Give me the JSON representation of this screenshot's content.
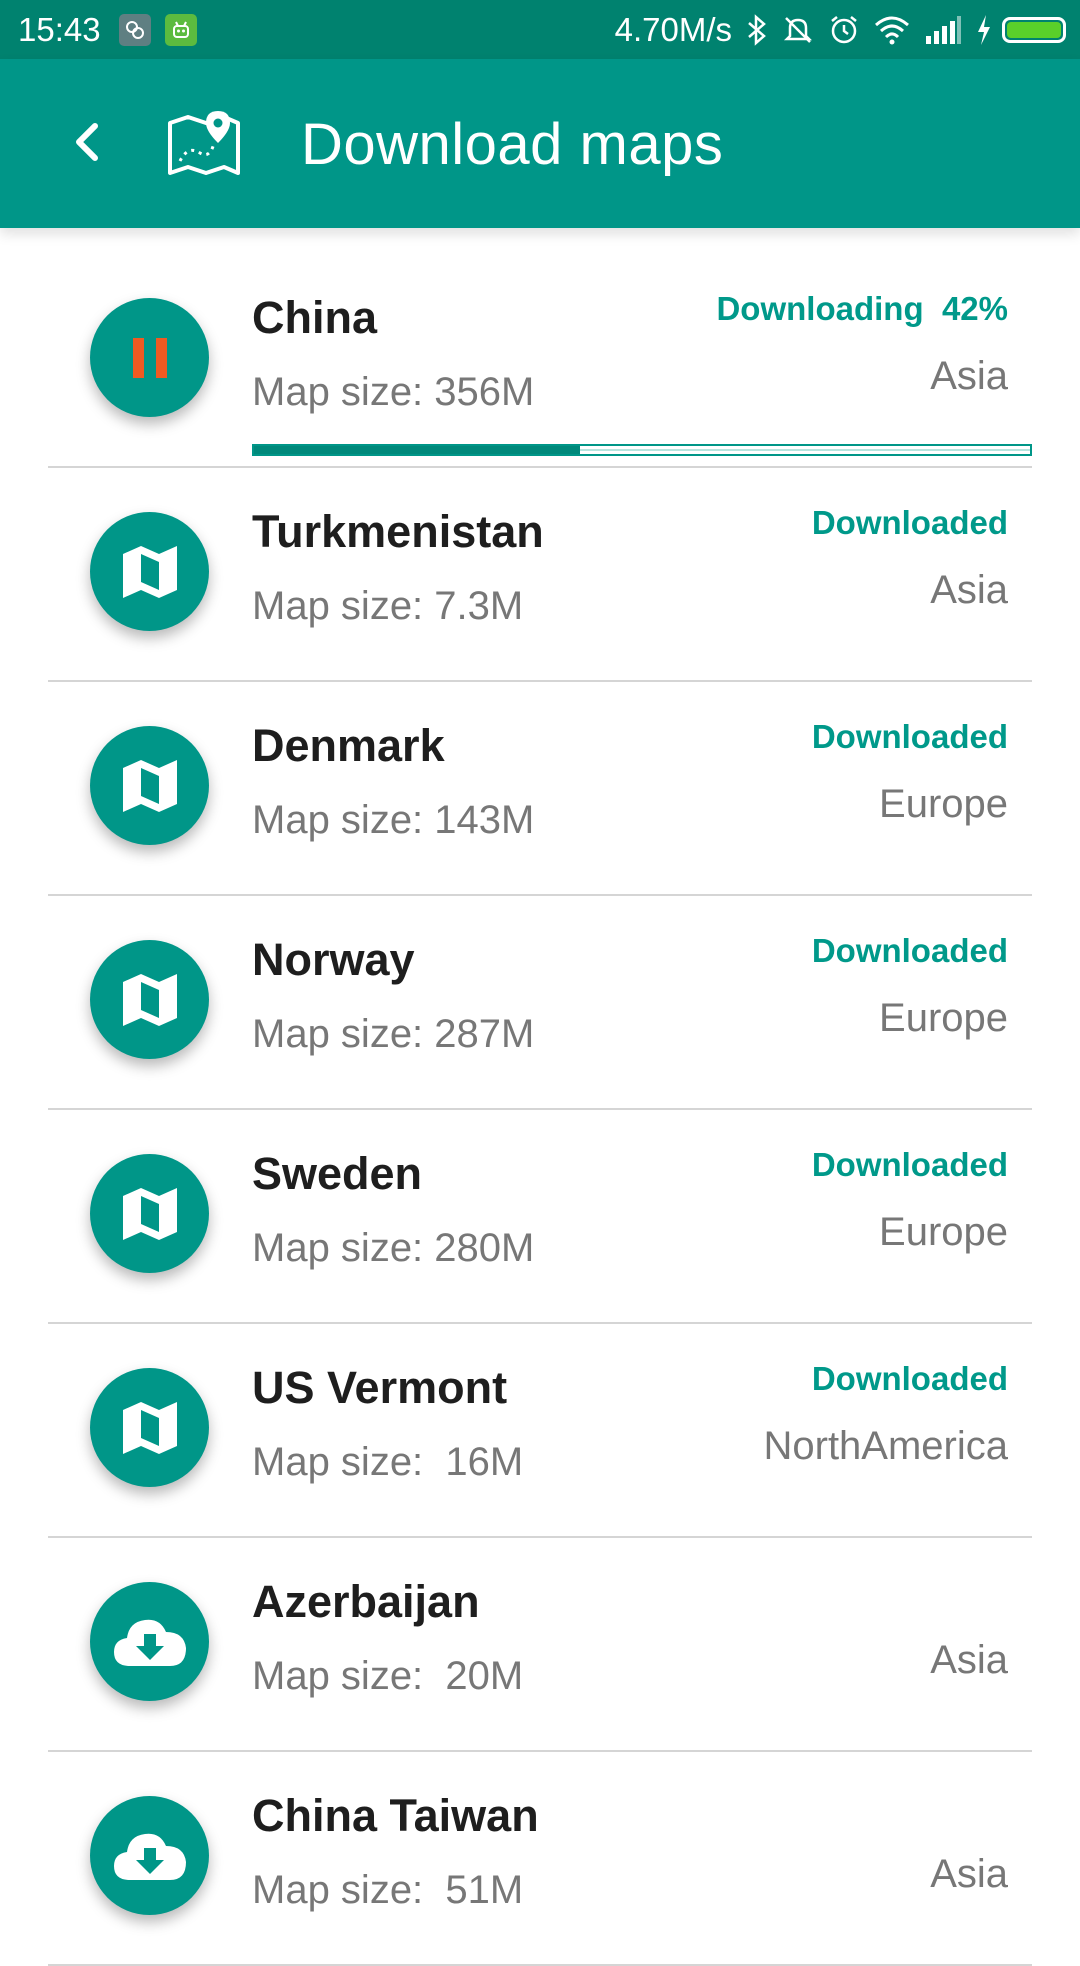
{
  "status_bar": {
    "time": "15:43",
    "speed": "4.70M/s",
    "icons": [
      "notification-app-icon",
      "android-icon",
      "bluetooth-icon",
      "silent-icon",
      "alarm-icon",
      "wifi-icon",
      "signal-icon",
      "charging-icon",
      "battery-icon"
    ]
  },
  "app_bar": {
    "title": "Download maps",
    "back_icon": "back-icon",
    "logo_icon": "map-pin-logo-icon"
  },
  "colors": {
    "primary": "#009688",
    "status_bar": "#00826f",
    "accent_text": "#00998a",
    "pause": "#f05a22"
  },
  "items": [
    {
      "name": "China",
      "size": "Map size: 356M",
      "status": "Downloading  42%",
      "region": "Asia",
      "icon": "pause-icon",
      "progress": 0.42
    },
    {
      "name": "Turkmenistan",
      "size": "Map size: 7.3M",
      "status": "Downloaded",
      "region": "Asia",
      "icon": "map-icon"
    },
    {
      "name": "Denmark",
      "size": "Map size: 143M",
      "status": "Downloaded",
      "region": "Europe",
      "icon": "map-icon"
    },
    {
      "name": "Norway",
      "size": "Map size: 287M",
      "status": "Downloaded",
      "region": "Europe",
      "icon": "map-icon"
    },
    {
      "name": "Sweden",
      "size": "Map size: 280M",
      "status": "Downloaded",
      "region": "Europe",
      "icon": "map-icon"
    },
    {
      "name": "US Vermont",
      "size": "Map size:  16M",
      "status": "Downloaded",
      "region": "NorthAmerica",
      "icon": "map-icon"
    },
    {
      "name": "Azerbaijan",
      "size": "Map size:  20M",
      "status": "",
      "region": "Asia",
      "icon": "cloud-download-icon"
    },
    {
      "name": "China Taiwan",
      "size": "Map size:  51M",
      "status": "",
      "region": "Asia",
      "icon": "cloud-download-icon"
    }
  ]
}
